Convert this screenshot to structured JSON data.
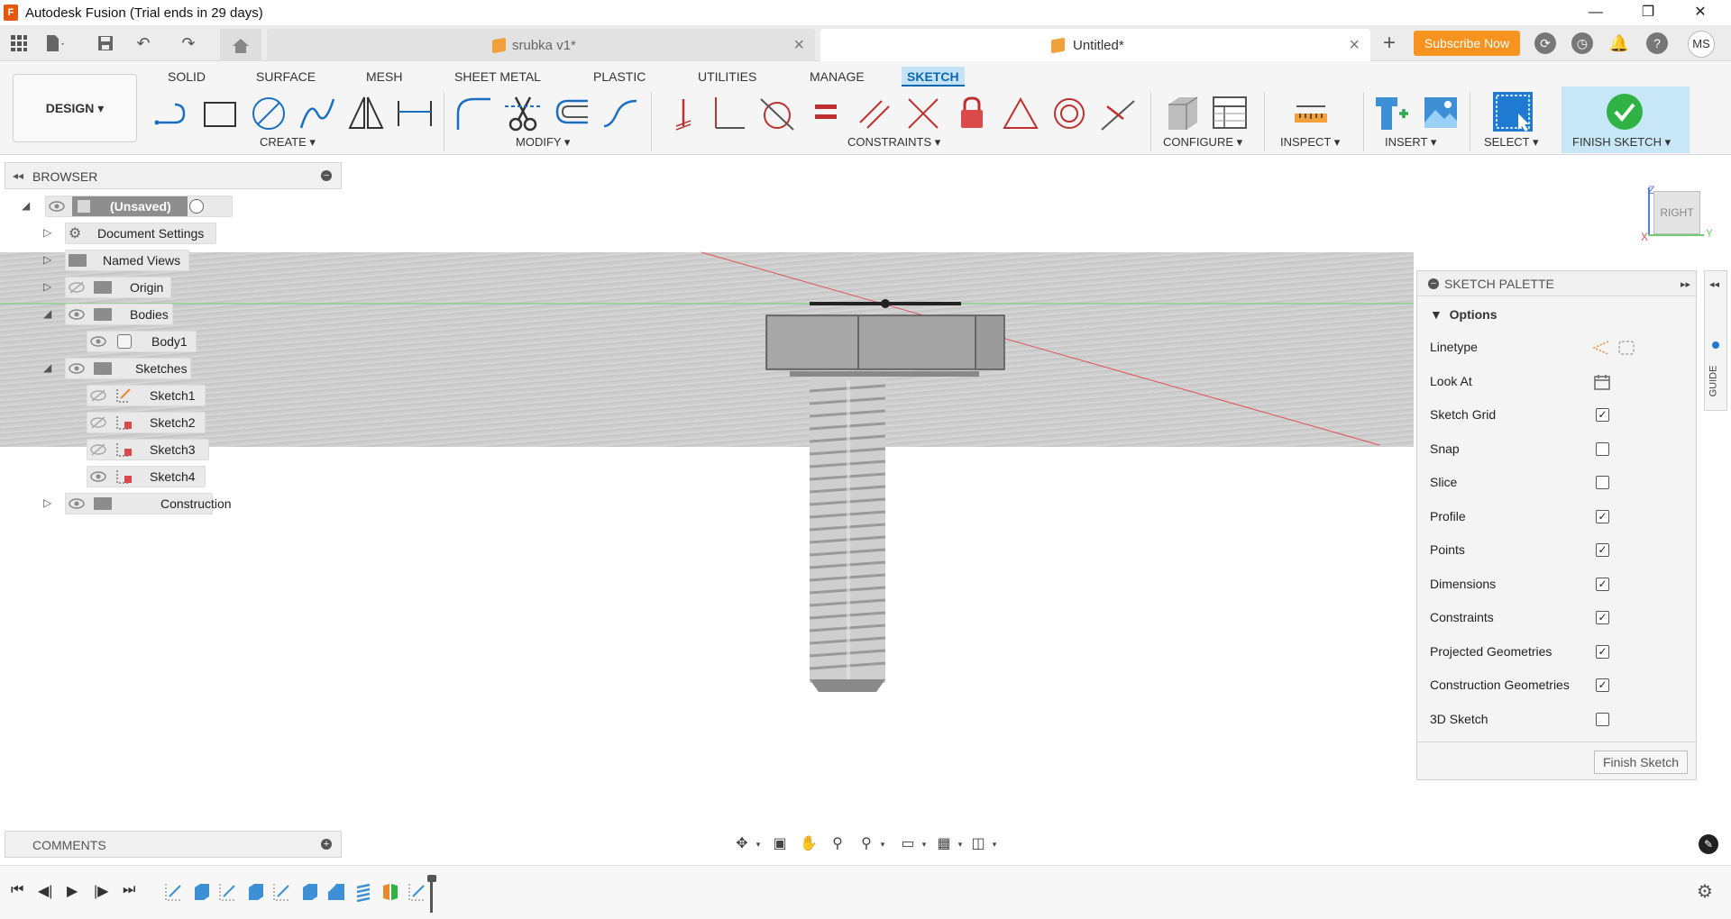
{
  "window": {
    "title": "Autodesk Fusion (Trial ends in 29 days)",
    "controls": [
      "—",
      "❐",
      "✕"
    ]
  },
  "tabs": [
    {
      "label": "srubka v1*",
      "active": false
    },
    {
      "label": "Untitled*",
      "active": true
    }
  ],
  "header": {
    "subscribe_label": "Subscribe Now",
    "user_initials": "MS"
  },
  "ribbon": {
    "workspace_label": "DESIGN ▾",
    "tabs": [
      "SOLID",
      "SURFACE",
      "MESH",
      "SHEET METAL",
      "PLASTIC",
      "UTILITIES",
      "MANAGE",
      "SKETCH"
    ],
    "active_tab": "SKETCH",
    "groups": {
      "create": "CREATE ▾",
      "modify": "MODIFY ▾",
      "constraints": "CONSTRAINTS ▾",
      "configure": "CONFIGURE ▾",
      "inspect": "INSPECT ▾",
      "insert": "INSERT ▾",
      "select": "SELECT ▾",
      "finish": "FINISH SKETCH ▾"
    },
    "accent_color": "#0b68b0"
  },
  "browser": {
    "title": "BROWSER",
    "root": "(Unsaved)",
    "items": {
      "document_settings": "Document Settings",
      "named_views": "Named Views",
      "origin": "Origin",
      "bodies": "Bodies",
      "body1": "Body1",
      "sketches": "Sketches",
      "sketch1": "Sketch1",
      "sketch2": "Sketch2",
      "sketch3": "Sketch3",
      "sketch4": "Sketch4",
      "construction": "Construction"
    }
  },
  "viewcube": {
    "face": "RIGHT",
    "axis_z": "Z",
    "axis_y": "Y",
    "axis_x": "X"
  },
  "palette": {
    "title": "SKETCH PALETTE",
    "section": "Options",
    "options": [
      {
        "label": "Linetype",
        "type": "icons"
      },
      {
        "label": "Look At",
        "type": "icon"
      },
      {
        "label": "Sketch Grid",
        "checked": true
      },
      {
        "label": "Snap",
        "checked": false
      },
      {
        "label": "Slice",
        "checked": false
      },
      {
        "label": "Profile",
        "checked": true
      },
      {
        "label": "Points",
        "checked": true
      },
      {
        "label": "Dimensions",
        "checked": true
      },
      {
        "label": "Constraints",
        "checked": true
      },
      {
        "label": "Projected Geometries",
        "checked": true
      },
      {
        "label": "Construction Geometries",
        "checked": true
      },
      {
        "label": "3D Sketch",
        "checked": false
      }
    ],
    "finish_label": "Finish Sketch",
    "guide_label": "GUIDE"
  },
  "comments": {
    "title": "COMMENTS"
  }
}
